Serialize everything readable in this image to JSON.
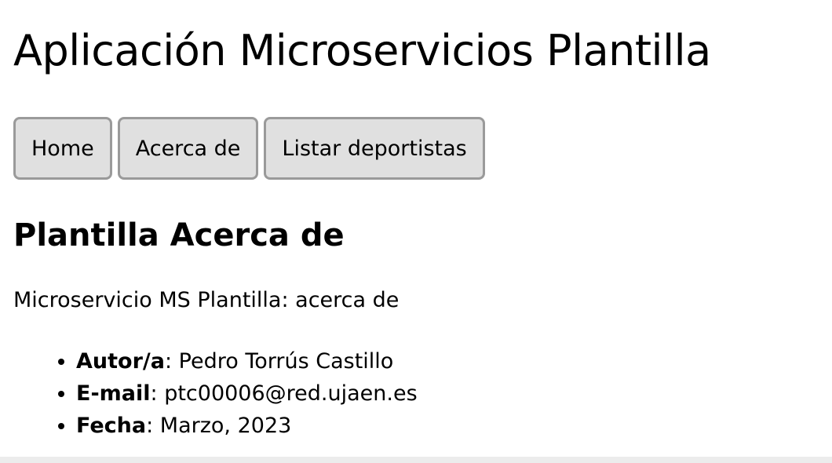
{
  "header": {
    "title": "Aplicación Microservicios Plantilla"
  },
  "nav": {
    "items": [
      {
        "label": "Home"
      },
      {
        "label": "Acerca de"
      },
      {
        "label": "Listar deportistas"
      }
    ]
  },
  "main": {
    "title": "Plantilla Acerca de",
    "description": "Microservicio MS Plantilla: acerca de",
    "info": [
      {
        "key": "Autor/a",
        "value": ": Pedro Torrús Castillo"
      },
      {
        "key": "E-mail",
        "value": ": ptc00006@red.ujaen.es"
      },
      {
        "key": "Fecha",
        "value": ": Marzo, 2023"
      }
    ]
  }
}
